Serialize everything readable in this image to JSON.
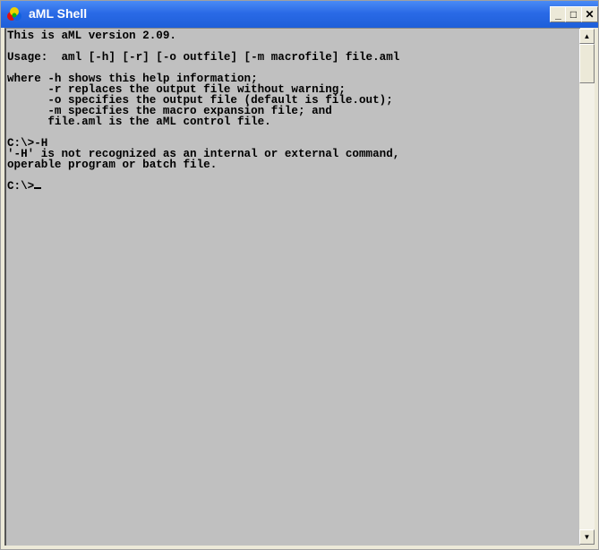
{
  "window": {
    "title": "aML Shell",
    "controls": {
      "minimize": "_",
      "maximize": "□",
      "close": "✕"
    }
  },
  "console": {
    "lines": [
      "This is aML version 2.09.",
      "",
      "Usage:  aml [-h] [-r] [-o outfile] [-m macrofile] file.aml",
      "",
      "where -h shows this help information;",
      "      -r replaces the output file without warning;",
      "      -o specifies the output file (default is file.out);",
      "      -m specifies the macro expansion file; and",
      "      file.aml is the aML control file.",
      "",
      "C:\\>-H",
      "'-H' is not recognized as an internal or external command,",
      "operable program or batch file.",
      "",
      "C:\\>"
    ]
  },
  "scrollbar": {
    "up_icon": "▲",
    "down_icon": "▼",
    "position": 0
  }
}
